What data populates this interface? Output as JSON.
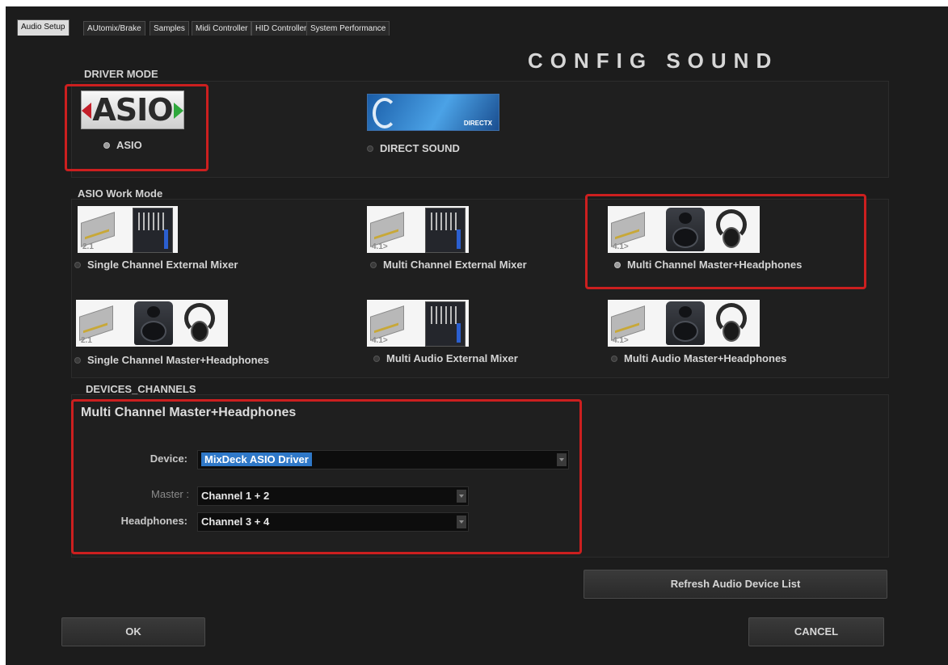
{
  "tabs": [
    {
      "label": "Audio Setup",
      "active": true
    },
    {
      "label": "AUtomix/Brake",
      "active": false
    },
    {
      "label": "Samples",
      "active": false
    },
    {
      "label": "Midi Controller",
      "active": false
    },
    {
      "label": "HID Controller",
      "active": false
    },
    {
      "label": "System Performance",
      "active": false
    }
  ],
  "title": "CONFIG  SOUND",
  "driver_mode": {
    "label": "DRIVER MODE",
    "asio_logo_text": "ASIO",
    "directx_logo_text": "DIRECTX",
    "options": [
      {
        "label": "ASIO",
        "selected": true
      },
      {
        "label": "DIRECT SOUND",
        "selected": false
      }
    ]
  },
  "work_mode": {
    "label": "ASIO Work Mode",
    "options": [
      {
        "label": "Single Channel External Mixer",
        "thumb_label": "2.1",
        "icons": [
          "sound-card-icon",
          "mixer-icon"
        ],
        "selected": false
      },
      {
        "label": "Multi Channel External Mixer",
        "thumb_label": "4.1>",
        "icons": [
          "sound-card-icon",
          "mixer-icon"
        ],
        "selected": false
      },
      {
        "label": "Multi Channel Master+Headphones",
        "thumb_label": "4.1>",
        "icons": [
          "sound-card-icon",
          "speaker-icon",
          "headphones-icon"
        ],
        "selected": true
      },
      {
        "label": "Single Channel Master+Headphones",
        "thumb_label": "2.1",
        "icons": [
          "sound-card-icon",
          "speaker-icon",
          "headphones-icon"
        ],
        "selected": false
      },
      {
        "label": "Multi Audio External Mixer",
        "thumb_label": "4.1>",
        "icons": [
          "sound-card-icon",
          "mixer-icon"
        ],
        "selected": false
      },
      {
        "label": "Multi Audio Master+Headphones",
        "thumb_label": "4.1>",
        "icons": [
          "sound-card-icon",
          "speaker-icon",
          "headphones-icon"
        ],
        "selected": false
      }
    ]
  },
  "devices": {
    "label": "DEVICES_CHANNELS",
    "section_title": "Multi Channel Master+Headphones",
    "device_label": "Device:",
    "device_value": "MixDeck ASIO Driver",
    "master_label": "Master :",
    "master_value": "Channel 1 + 2",
    "headphones_label": "Headphones:",
    "headphones_value": "Channel 3 + 4"
  },
  "buttons": {
    "refresh": "Refresh Audio Device List",
    "ok": "OK",
    "cancel": "CANCEL"
  },
  "colors": {
    "background": "#1c1c1c",
    "highlight_box": "#cc1f1f",
    "selection": "#2f78c8"
  }
}
